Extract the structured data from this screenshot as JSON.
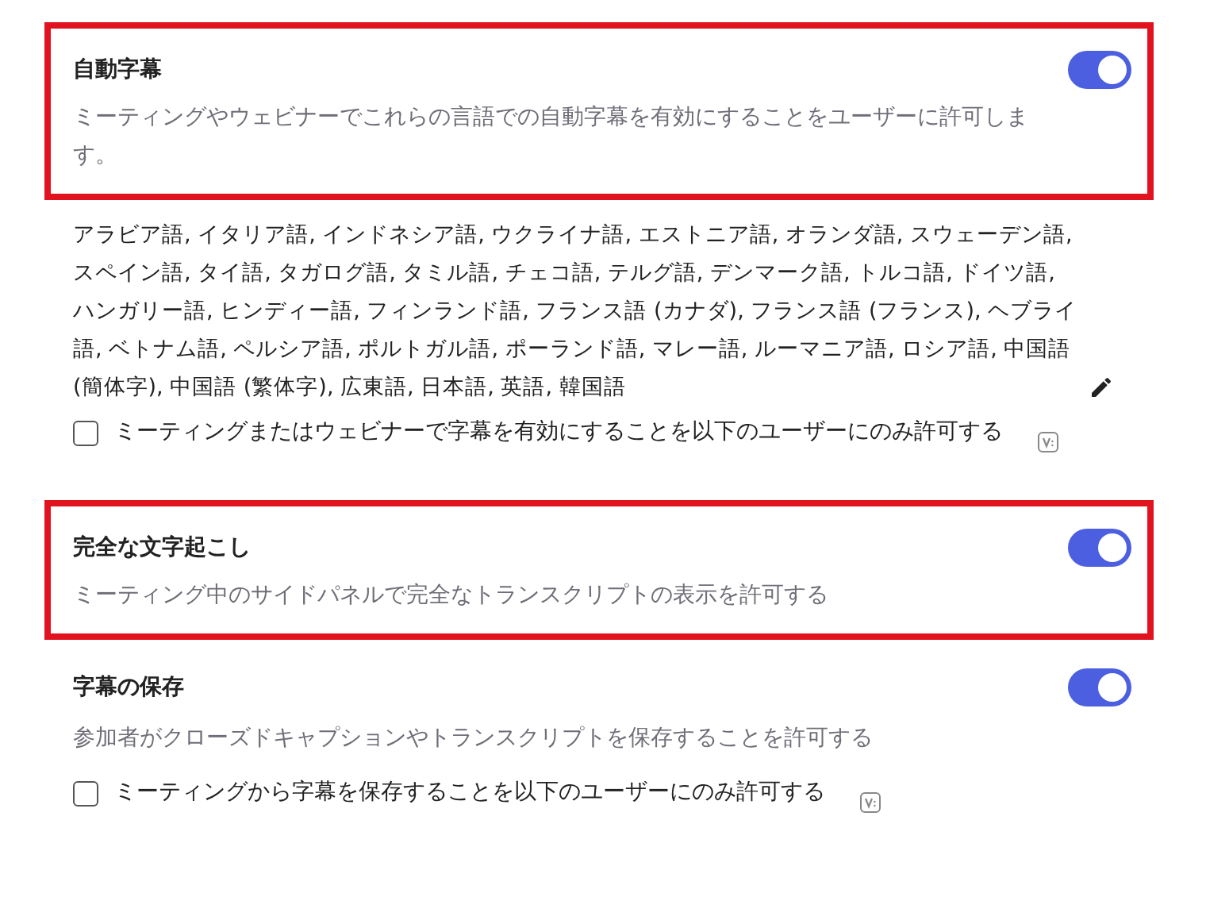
{
  "settings": [
    {
      "title": "自動字幕",
      "description": "ミーティングやウェビナーでこれらの言語での自動字幕を有効にすることをユーザーに許可します。",
      "enabled": true,
      "highlighted": true,
      "languages": "アラビア語, イタリア語, インドネシア語, ウクライナ語, エストニア語, オランダ語, スウェーデン語, スペイン語, タイ語, タガログ語, タミル語, チェコ語, テルグ語, デンマーク語, トルコ語, ドイツ語, ハンガリー語, ヒンディー語, フィンランド語, フランス語 (カナダ), フランス語 (フランス), ヘブライ語, ベトナム語, ペルシア語, ポルトガル語, ポーランド語, マレー語, ルーマニア語, ロシア語, 中国語 (簡体字), 中国語 (繁体字), 広東語, 日本語, 英語, 韓国語",
      "checkbox": {
        "label": "ミーティングまたはウェビナーで字幕を有効にすることを以下のユーザーにのみ許可する",
        "checked": false
      }
    },
    {
      "title": "完全な文字起こし",
      "description": "ミーティング中のサイドパネルで完全なトランスクリプトの表示を許可する",
      "enabled": true,
      "highlighted": true
    },
    {
      "title": "字幕の保存",
      "description": "参加者がクローズドキャプションやトランスクリプトを保存することを許可する",
      "enabled": true,
      "highlighted": false,
      "checkbox": {
        "label": "ミーティングから字幕を保存することを以下のユーザーにのみ許可する",
        "checked": false
      }
    }
  ]
}
